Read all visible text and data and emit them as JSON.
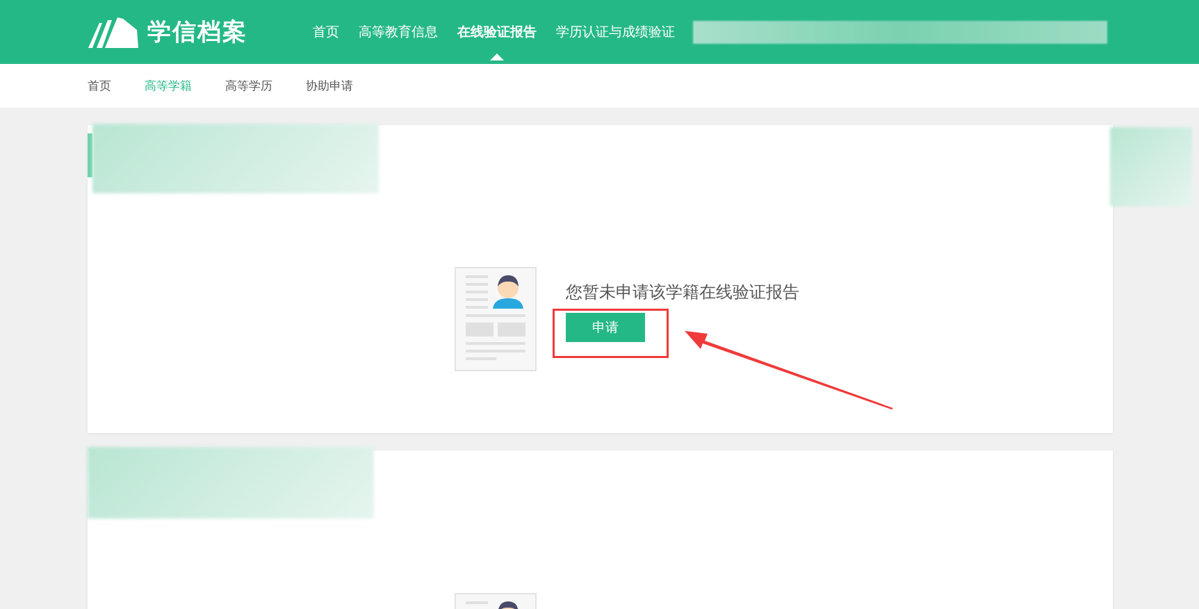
{
  "header": {
    "logo_text": "学信档案",
    "nav": [
      {
        "label": "首页",
        "selected": false
      },
      {
        "label": "高等教育信息",
        "selected": false
      },
      {
        "label": "在线验证报告",
        "selected": true
      },
      {
        "label": "学历认证与成绩验证",
        "selected": false
      }
    ]
  },
  "subnav": [
    {
      "label": "首页",
      "selected": false
    },
    {
      "label": "高等学籍",
      "selected": true
    },
    {
      "label": "高等学历",
      "selected": false
    },
    {
      "label": "协助申请",
      "selected": false
    }
  ],
  "cards": [
    {
      "message": "您暂未申请该学籍在线验证报告",
      "button": "申请"
    }
  ]
}
